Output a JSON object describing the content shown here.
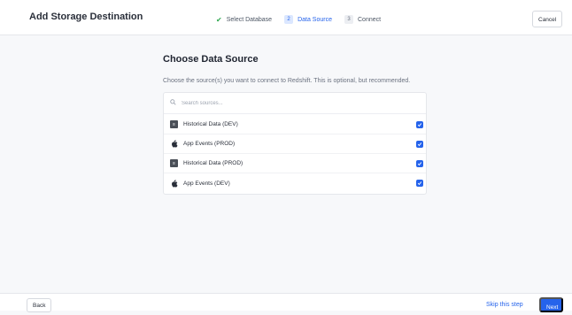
{
  "header": {
    "title": "Add Storage Destination",
    "steps": [
      {
        "number": "",
        "label": "Select Database",
        "state": "complete",
        "icon": "check-icon"
      },
      {
        "number": "2",
        "label": "Data Source",
        "state": "active"
      },
      {
        "number": "3",
        "label": "Connect",
        "state": "todo"
      }
    ],
    "cancel_label": "Cancel"
  },
  "main": {
    "title": "Choose Data Source",
    "description": "Choose the source(s) you want to connect to Redshift. This is optional, but recommended.",
    "search": {
      "placeholder": "Search sources...",
      "value": "",
      "icon": "search-icon"
    },
    "sources": [
      {
        "label": "Historical Data (DEV)",
        "icon": "database-icon",
        "checked": true
      },
      {
        "label": "App Events (PROD)",
        "icon": "apple-icon",
        "checked": true
      },
      {
        "label": "Historical Data (PROD)",
        "icon": "database-icon",
        "checked": true
      },
      {
        "label": "App Events (DEV)",
        "icon": "apple-icon",
        "checked": true
      }
    ]
  },
  "footer": {
    "back_label": "Back",
    "skip_label": "Skip this step",
    "next_label": "Next"
  },
  "colors": {
    "accent": "#2563eb",
    "success": "#2fa84f",
    "background": "#f7f8fa"
  }
}
